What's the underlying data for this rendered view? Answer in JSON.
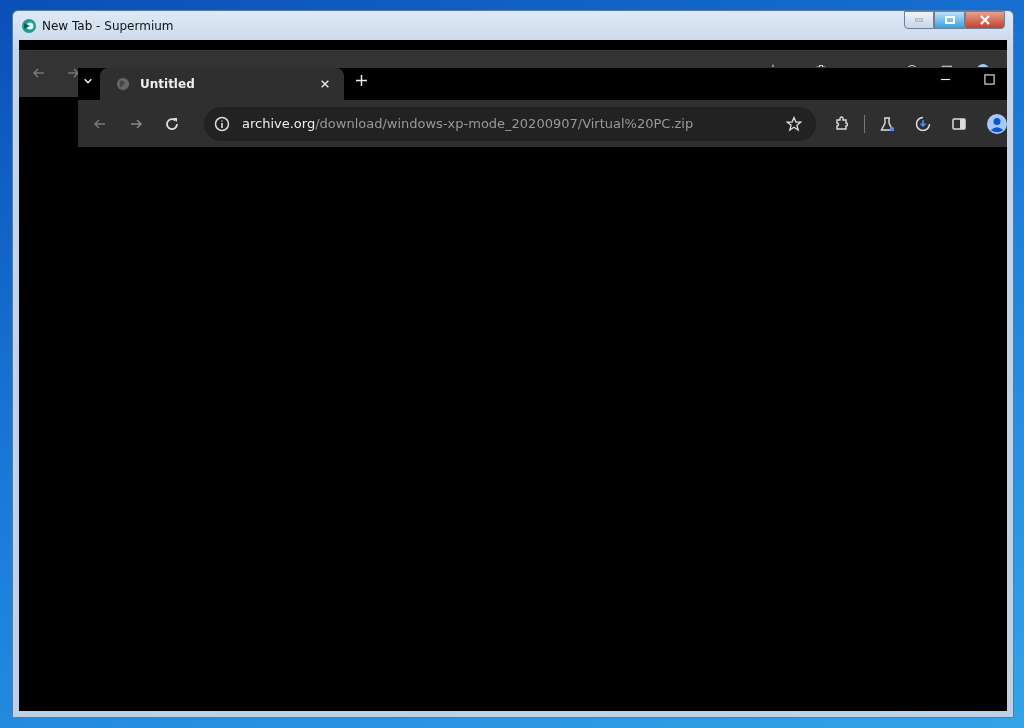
{
  "window": {
    "title": "New Tab - Supermium"
  },
  "browser": {
    "tabs": [
      {
        "title": "Untitled",
        "selected": true
      }
    ],
    "address": {
      "host": "archive.org",
      "path": "/download/windows-xp-mode_20200907/Virtual%20PC.zip"
    }
  }
}
